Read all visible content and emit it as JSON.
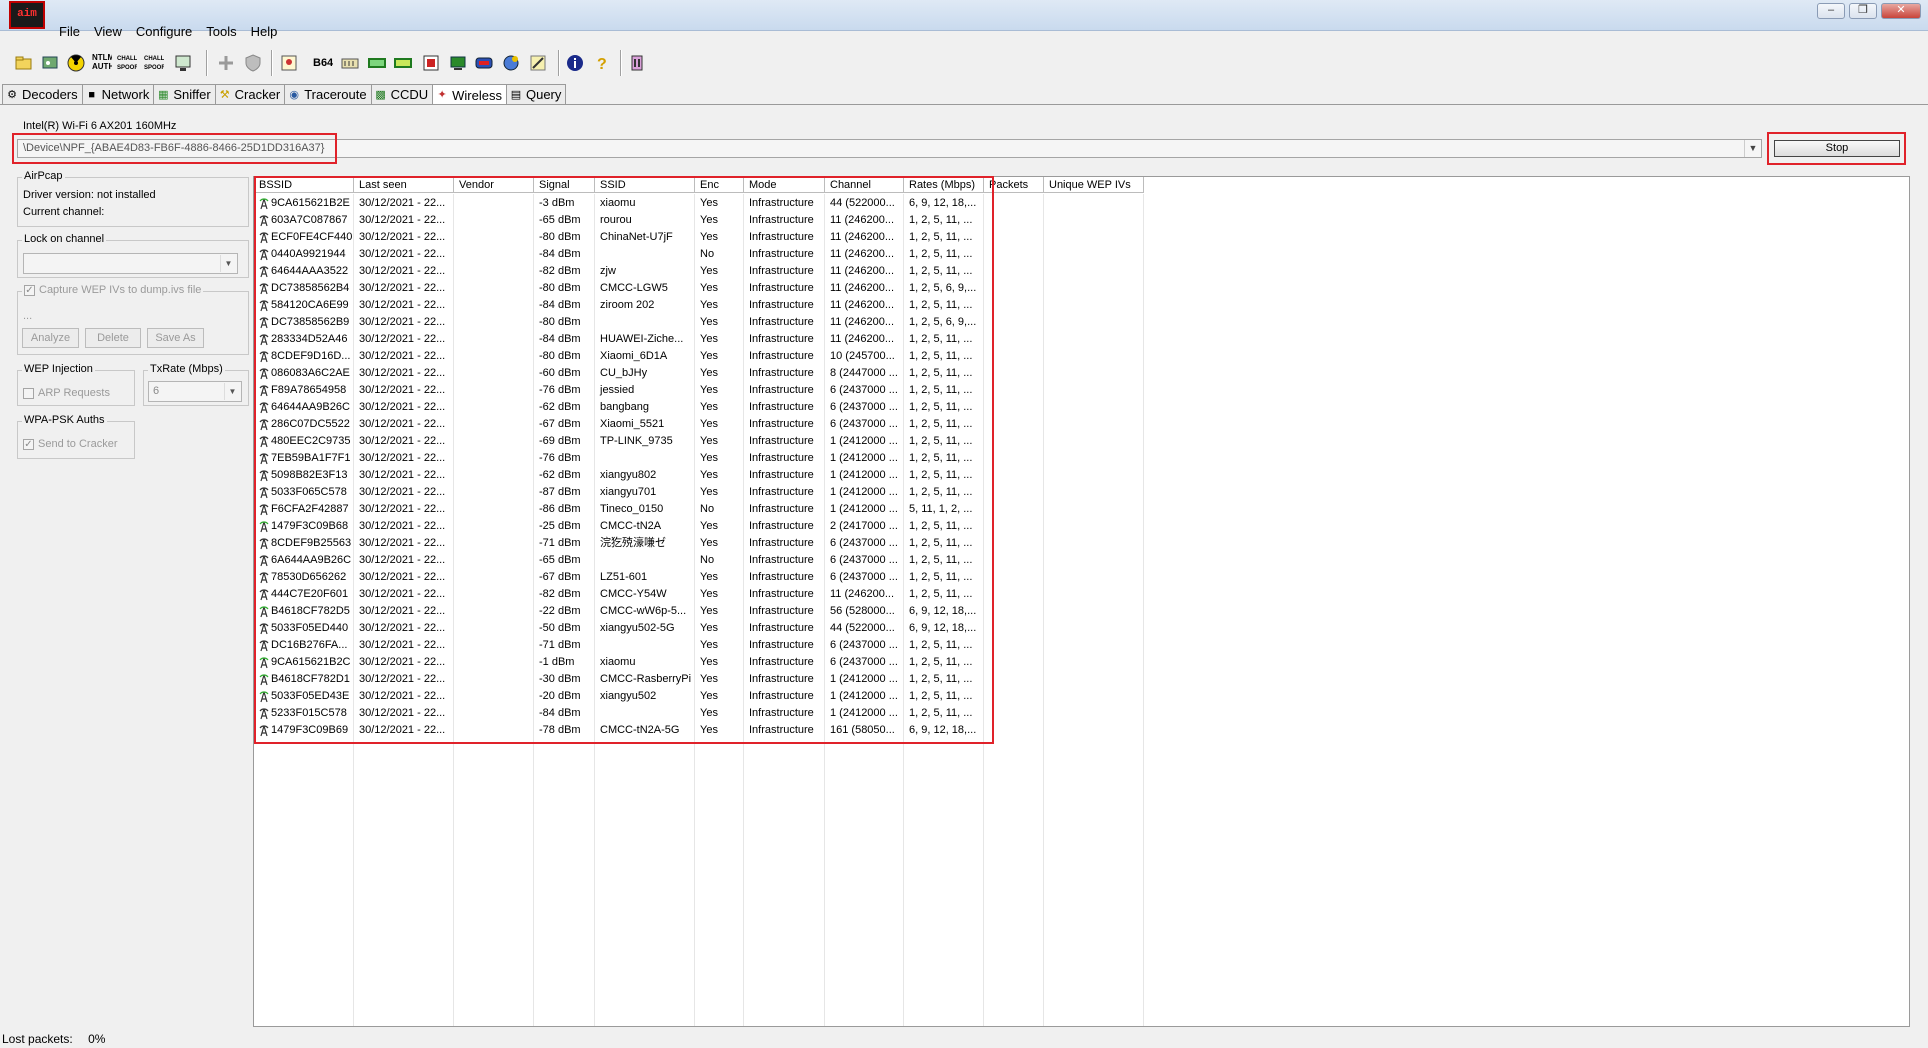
{
  "app": {
    "logo_text": "aim"
  },
  "menu": [
    "File",
    "View",
    "Configure",
    "Tools",
    "Help"
  ],
  "toolbar_icons": [
    "open-icon",
    "network-adapter-icon",
    "radiation-icon",
    "ntlm-auth-icon",
    "chall-spoof-reset-icon",
    "chall-spoof-ntlm-icon",
    "lcd-icon",
    "add-icon",
    "shield-icon",
    "certificate-icon",
    "base64-icon",
    "hash-icon",
    "md2-icon",
    "md5-icon",
    "chip-icon",
    "pc-icon",
    "nic-icon",
    "globe-icon",
    "wand-icon",
    "info-icon",
    "help-icon",
    "tower-icon"
  ],
  "toolbar_labels": {
    "ntlm": "NTLM AUTH",
    "chall_reset": "CHALL SPOOF RESET",
    "chall_ntlm": "CHALL SPOOF NTLM",
    "b64": "B64"
  },
  "tabs": [
    {
      "label": "Decoders",
      "icon": "decoders-icon",
      "active": false
    },
    {
      "label": "Network",
      "icon": "network-icon",
      "active": false
    },
    {
      "label": "Sniffer",
      "icon": "sniffer-icon",
      "active": false
    },
    {
      "label": "Cracker",
      "icon": "cracker-icon",
      "active": false
    },
    {
      "label": "Traceroute",
      "icon": "traceroute-icon",
      "active": false
    },
    {
      "label": "CCDU",
      "icon": "ccdu-icon",
      "active": false
    },
    {
      "label": "Wireless",
      "icon": "wireless-icon",
      "active": true
    },
    {
      "label": "Query",
      "icon": "query-icon",
      "active": false
    }
  ],
  "adapter": {
    "name": "Intel(R) Wi-Fi 6 AX201 160MHz",
    "device": "\\Device\\NPF_{ABAE4D83-FB6F-4886-8466-25D1DD316A37}",
    "stop_label": "Stop"
  },
  "airpcap": {
    "title": "AirPcap",
    "driver": "Driver version: not installed",
    "channel": "Current channel:"
  },
  "lock_channel": {
    "title": "Lock on channel"
  },
  "capture": {
    "label": "Capture WEP IVs to dump.ivs file",
    "dots": "...",
    "analyze": "Analyze",
    "delete": "Delete",
    "save_as": "Save As"
  },
  "wep": {
    "title": "WEP Injection",
    "arp": "ARP Requests"
  },
  "txrate": {
    "title": "TxRate (Mbps)",
    "value": "6"
  },
  "wpa": {
    "title": "WPA-PSK Auths",
    "send": "Send to Cracker"
  },
  "columns": [
    "BSSID",
    "Last seen",
    "Vendor",
    "Signal",
    "SSID",
    "Enc",
    "Mode",
    "Channel",
    "Rates (Mbps)",
    "Packets",
    "Unique WEP IVs"
  ],
  "rows": [
    {
      "bssid": "9CA615621B2E",
      "last": "30/12/2021 - 22...",
      "vendor": "",
      "signal": "-3 dBm",
      "ssid": "xiaomu",
      "enc": "Yes",
      "mode": "Infrastructure",
      "channel": "44 (522000...",
      "rates": "6, 9, 12, 18,...",
      "strong": true
    },
    {
      "bssid": "603A7C087867",
      "last": "30/12/2021 - 22...",
      "vendor": "",
      "signal": "-65 dBm",
      "ssid": "rourou",
      "enc": "Yes",
      "mode": "Infrastructure",
      "channel": "11 (246200...",
      "rates": "1, 2, 5, 11, ...",
      "strong": false
    },
    {
      "bssid": "ECF0FE4CF440",
      "last": "30/12/2021 - 22...",
      "vendor": "",
      "signal": "-80 dBm",
      "ssid": "ChinaNet-U7jF",
      "enc": "Yes",
      "mode": "Infrastructure",
      "channel": "11 (246200...",
      "rates": "1, 2, 5, 11, ...",
      "strong": false
    },
    {
      "bssid": "0440A9921944",
      "last": "30/12/2021 - 22...",
      "vendor": "",
      "signal": "-84 dBm",
      "ssid": "",
      "enc": "No",
      "mode": "Infrastructure",
      "channel": "11 (246200...",
      "rates": "1, 2, 5, 11, ...",
      "strong": false
    },
    {
      "bssid": "64644AAA3522",
      "last": "30/12/2021 - 22...",
      "vendor": "",
      "signal": "-82 dBm",
      "ssid": "zjw",
      "enc": "Yes",
      "mode": "Infrastructure",
      "channel": "11 (246200...",
      "rates": "1, 2, 5, 11, ...",
      "strong": false
    },
    {
      "bssid": "DC73858562B4",
      "last": "30/12/2021 - 22...",
      "vendor": "",
      "signal": "-80 dBm",
      "ssid": "CMCC-LGW5",
      "enc": "Yes",
      "mode": "Infrastructure",
      "channel": "11 (246200...",
      "rates": "1, 2, 5, 6, 9,...",
      "strong": false
    },
    {
      "bssid": "584120CA6E99",
      "last": "30/12/2021 - 22...",
      "vendor": "",
      "signal": "-84 dBm",
      "ssid": "ziroom 202",
      "enc": "Yes",
      "mode": "Infrastructure",
      "channel": "11 (246200...",
      "rates": "1, 2, 5, 11, ...",
      "strong": false
    },
    {
      "bssid": "DC73858562B9",
      "last": "30/12/2021 - 22...",
      "vendor": "",
      "signal": "-80 dBm",
      "ssid": "",
      "enc": "Yes",
      "mode": "Infrastructure",
      "channel": "11 (246200...",
      "rates": "1, 2, 5, 6, 9,...",
      "strong": false
    },
    {
      "bssid": "283334D52A46",
      "last": "30/12/2021 - 22...",
      "vendor": "",
      "signal": "-84 dBm",
      "ssid": "HUAWEI-Ziche...",
      "enc": "Yes",
      "mode": "Infrastructure",
      "channel": "11 (246200...",
      "rates": "1, 2, 5, 11, ...",
      "strong": false
    },
    {
      "bssid": "8CDEF9D16D...",
      "last": "30/12/2021 - 22...",
      "vendor": "",
      "signal": "-80 dBm",
      "ssid": "Xiaomi_6D1A",
      "enc": "Yes",
      "mode": "Infrastructure",
      "channel": "10 (245700...",
      "rates": "1, 2, 5, 11, ...",
      "strong": false
    },
    {
      "bssid": "086083A6C2AE",
      "last": "30/12/2021 - 22...",
      "vendor": "",
      "signal": "-60 dBm",
      "ssid": "CU_bJHy",
      "enc": "Yes",
      "mode": "Infrastructure",
      "channel": "8 (2447000 ...",
      "rates": "1, 2, 5, 11, ...",
      "strong": false
    },
    {
      "bssid": "F89A78654958",
      "last": "30/12/2021 - 22...",
      "vendor": "",
      "signal": "-76 dBm",
      "ssid": "jessied",
      "enc": "Yes",
      "mode": "Infrastructure",
      "channel": "6 (2437000 ...",
      "rates": "1, 2, 5, 11, ...",
      "strong": false
    },
    {
      "bssid": "64644AA9B26C",
      "last": "30/12/2021 - 22...",
      "vendor": "",
      "signal": "-62 dBm",
      "ssid": "bangbang",
      "enc": "Yes",
      "mode": "Infrastructure",
      "channel": "6 (2437000 ...",
      "rates": "1, 2, 5, 11, ...",
      "strong": false
    },
    {
      "bssid": "286C07DC5522",
      "last": "30/12/2021 - 22...",
      "vendor": "",
      "signal": "-67 dBm",
      "ssid": "Xiaomi_5521",
      "enc": "Yes",
      "mode": "Infrastructure",
      "channel": "6 (2437000 ...",
      "rates": "1, 2, 5, 11, ...",
      "strong": false
    },
    {
      "bssid": "480EEC2C9735",
      "last": "30/12/2021 - 22...",
      "vendor": "",
      "signal": "-69 dBm",
      "ssid": "TP-LINK_9735",
      "enc": "Yes",
      "mode": "Infrastructure",
      "channel": "1 (2412000 ...",
      "rates": "1, 2, 5, 11, ...",
      "strong": false
    },
    {
      "bssid": "7EB59BA1F7F1",
      "last": "30/12/2021 - 22...",
      "vendor": "",
      "signal": "-76 dBm",
      "ssid": "",
      "enc": "Yes",
      "mode": "Infrastructure",
      "channel": "1 (2412000 ...",
      "rates": "1, 2, 5, 11, ...",
      "strong": false
    },
    {
      "bssid": "5098B82E3F13",
      "last": "30/12/2021 - 22...",
      "vendor": "",
      "signal": "-62 dBm",
      "ssid": "xiangyu802",
      "enc": "Yes",
      "mode": "Infrastructure",
      "channel": "1 (2412000 ...",
      "rates": "1, 2, 5, 11, ...",
      "strong": false
    },
    {
      "bssid": "5033F065C578",
      "last": "30/12/2021 - 22...",
      "vendor": "",
      "signal": "-87 dBm",
      "ssid": "xiangyu701",
      "enc": "Yes",
      "mode": "Infrastructure",
      "channel": "1 (2412000 ...",
      "rates": "1, 2, 5, 11, ...",
      "strong": false
    },
    {
      "bssid": "F6CFA2F42887",
      "last": "30/12/2021 - 22...",
      "vendor": "",
      "signal": "-86 dBm",
      "ssid": "Tineco_0150",
      "enc": "No",
      "mode": "Infrastructure",
      "channel": "1 (2412000 ...",
      "rates": "5, 11, 1, 2, ...",
      "strong": false
    },
    {
      "bssid": "1479F3C09B68",
      "last": "30/12/2021 - 22...",
      "vendor": "",
      "signal": "-25 dBm",
      "ssid": "CMCC-tN2A",
      "enc": "Yes",
      "mode": "Infrastructure",
      "channel": "2 (2417000 ...",
      "rates": "1, 2, 5, 11, ...",
      "strong": true
    },
    {
      "bssid": "8CDEF9B25563",
      "last": "30/12/2021 - 22...",
      "vendor": "",
      "signal": "-71 dBm",
      "ssid": "浣犵殑濠嗛ゼ",
      "enc": "Yes",
      "mode": "Infrastructure",
      "channel": "6 (2437000 ...",
      "rates": "1, 2, 5, 11, ...",
      "strong": false
    },
    {
      "bssid": "6A644AA9B26C",
      "last": "30/12/2021 - 22...",
      "vendor": "",
      "signal": "-65 dBm",
      "ssid": "",
      "enc": "No",
      "mode": "Infrastructure",
      "channel": "6 (2437000 ...",
      "rates": "1, 2, 5, 11, ...",
      "strong": false
    },
    {
      "bssid": "78530D656262",
      "last": "30/12/2021 - 22...",
      "vendor": "",
      "signal": "-67 dBm",
      "ssid": "LZ51-601",
      "enc": "Yes",
      "mode": "Infrastructure",
      "channel": "6 (2437000 ...",
      "rates": "1, 2, 5, 11, ...",
      "strong": false
    },
    {
      "bssid": "444C7E20F601",
      "last": "30/12/2021 - 22...",
      "vendor": "",
      "signal": "-82 dBm",
      "ssid": "CMCC-Y54W",
      "enc": "Yes",
      "mode": "Infrastructure",
      "channel": "11 (246200...",
      "rates": "1, 2, 5, 11, ...",
      "strong": false
    },
    {
      "bssid": "B4618CF782D5",
      "last": "30/12/2021 - 22...",
      "vendor": "",
      "signal": "-22 dBm",
      "ssid": "CMCC-wW6p-5...",
      "enc": "Yes",
      "mode": "Infrastructure",
      "channel": "56 (528000...",
      "rates": "6, 9, 12, 18,...",
      "strong": true
    },
    {
      "bssid": "5033F05ED440",
      "last": "30/12/2021 - 22...",
      "vendor": "",
      "signal": "-50 dBm",
      "ssid": "xiangyu502-5G",
      "enc": "Yes",
      "mode": "Infrastructure",
      "channel": "44 (522000...",
      "rates": "6, 9, 12, 18,...",
      "strong": false
    },
    {
      "bssid": "DC16B276FA...",
      "last": "30/12/2021 - 22...",
      "vendor": "",
      "signal": "-71 dBm",
      "ssid": "",
      "enc": "Yes",
      "mode": "Infrastructure",
      "channel": "6 (2437000 ...",
      "rates": "1, 2, 5, 11, ...",
      "strong": false
    },
    {
      "bssid": "9CA615621B2C",
      "last": "30/12/2021 - 22...",
      "vendor": "",
      "signal": "-1 dBm",
      "ssid": "xiaomu",
      "enc": "Yes",
      "mode": "Infrastructure",
      "channel": "6 (2437000 ...",
      "rates": "1, 2, 5, 11, ...",
      "strong": true
    },
    {
      "bssid": "B4618CF782D1",
      "last": "30/12/2021 - 22...",
      "vendor": "",
      "signal": "-30 dBm",
      "ssid": "CMCC-RasberryPi",
      "enc": "Yes",
      "mode": "Infrastructure",
      "channel": "1 (2412000 ...",
      "rates": "1, 2, 5, 11, ...",
      "strong": true
    },
    {
      "bssid": "5033F05ED43E",
      "last": "30/12/2021 - 22...",
      "vendor": "",
      "signal": "-20 dBm",
      "ssid": "xiangyu502",
      "enc": "Yes",
      "mode": "Infrastructure",
      "channel": "1 (2412000 ...",
      "rates": "1, 2, 5, 11, ...",
      "strong": true
    },
    {
      "bssid": "5233F015C578",
      "last": "30/12/2021 - 22...",
      "vendor": "",
      "signal": "-84 dBm",
      "ssid": "",
      "enc": "Yes",
      "mode": "Infrastructure",
      "channel": "1 (2412000 ...",
      "rates": "1, 2, 5, 11, ...",
      "strong": false
    },
    {
      "bssid": "1479F3C09B69",
      "last": "30/12/2021 - 22...",
      "vendor": "",
      "signal": "-78 dBm",
      "ssid": "CMCC-tN2A-5G",
      "enc": "Yes",
      "mode": "Infrastructure",
      "channel": "161 (58050...",
      "rates": "6, 9, 12, 18,...",
      "strong": false
    }
  ],
  "status": {
    "lost_label": "Lost packets:",
    "lost_value": "0%"
  },
  "colors": {
    "highlight": "#e0222a",
    "antenna_strong": "#2fae2f"
  }
}
